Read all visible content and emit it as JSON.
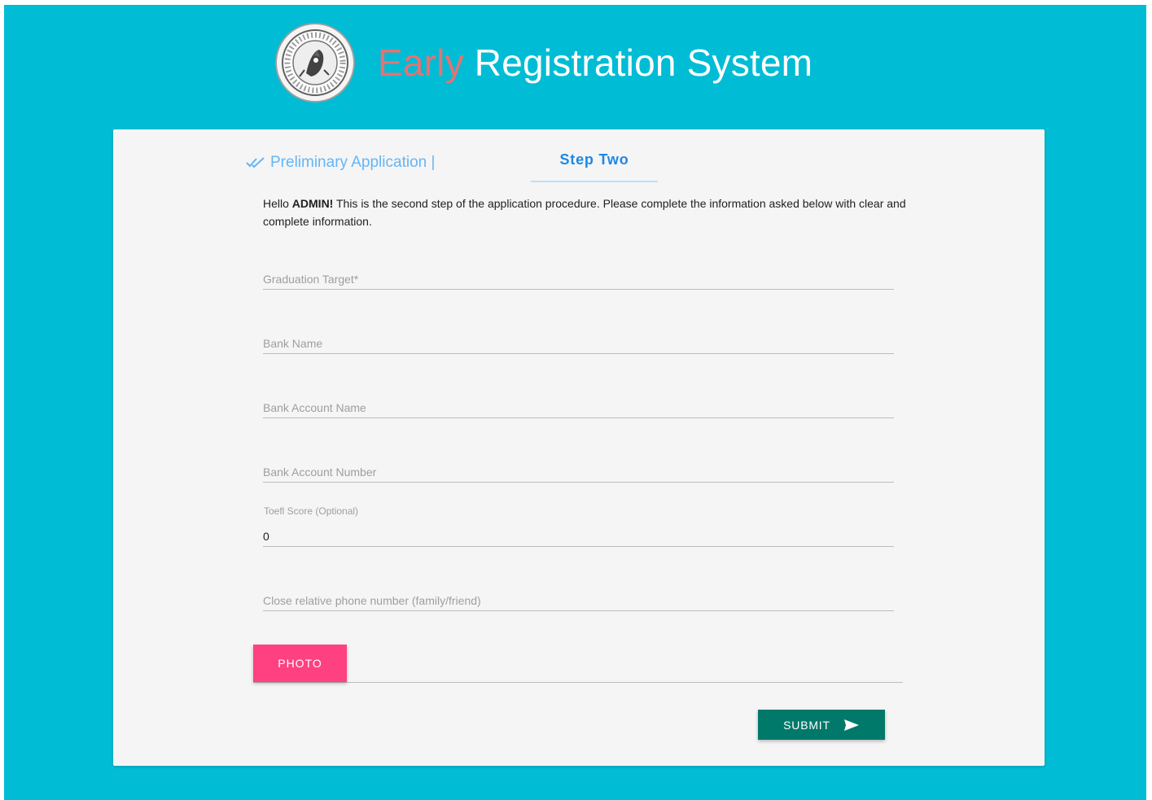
{
  "colors": {
    "background": "#00bcd4",
    "card": "#f5f5f5",
    "title_accent": "#e57373",
    "tab_prelim": "#64b5f6",
    "tab_active": "#1e88e5",
    "photo_button": "#ff4081",
    "submit_button": "#00796b"
  },
  "header": {
    "logo_icon": "seal-logo-icon",
    "title_accent": "Early",
    "title_rest": " Registration System"
  },
  "tabs": {
    "preliminary": {
      "icon": "double-check-icon",
      "label": "Preliminary Application |"
    },
    "active": {
      "label": "Step Two"
    }
  },
  "intro": {
    "greeting": "Hello ",
    "user": "ADMIN!",
    "message": " This is the second step of the application procedure. Please complete the information asked below with clear and complete information."
  },
  "form": {
    "graduation_target": {
      "placeholder": "Graduation Target*",
      "value": ""
    },
    "bank_name": {
      "placeholder": "Bank Name",
      "value": ""
    },
    "bank_account_name": {
      "placeholder": "Bank Account Name",
      "value": ""
    },
    "bank_account_number": {
      "placeholder": "Bank Account Number",
      "value": ""
    },
    "toefl_score": {
      "label": "Toefl Score (Optional)",
      "value": "0"
    },
    "relative_phone": {
      "placeholder": "Close relative phone number (family/friend)",
      "value": ""
    },
    "photo_button": "PHOTO",
    "submit_button": "SUBMIT",
    "submit_icon": "send-icon"
  }
}
